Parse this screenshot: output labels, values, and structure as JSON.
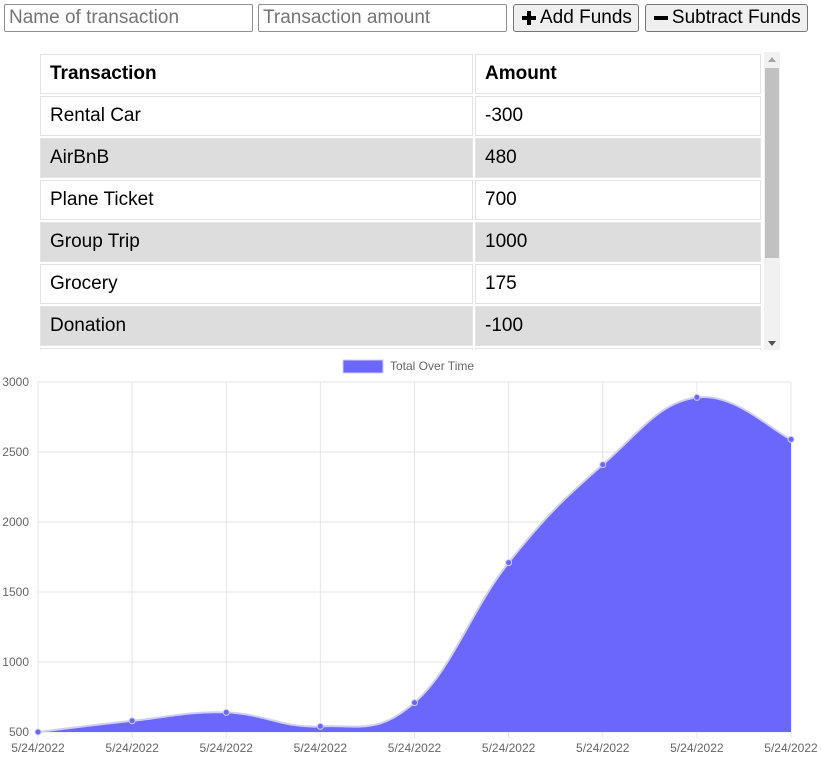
{
  "form": {
    "name_placeholder": "Name of transaction",
    "amount_placeholder": "Transaction amount",
    "add_label": "Add Funds",
    "subtract_label": "Subtract Funds"
  },
  "table": {
    "headers": [
      "Transaction",
      "Amount"
    ],
    "rows": [
      {
        "name": "Rental Car",
        "amount": "-300"
      },
      {
        "name": "AirBnB",
        "amount": "480"
      },
      {
        "name": "Plane Ticket",
        "amount": "700"
      },
      {
        "name": "Group Trip",
        "amount": "1000"
      },
      {
        "name": "Grocery",
        "amount": "175"
      },
      {
        "name": "Donation",
        "amount": "-100"
      }
    ]
  },
  "colors": {
    "fill": "#6b66fc",
    "line": "#cfcfff",
    "grid": "#e5e5e5",
    "row_alt": "#dddddd"
  },
  "chart_data": {
    "type": "area",
    "legend": "Total Over Time",
    "legend_position": "top-center",
    "x": [
      "5/24/2022",
      "5/24/2022",
      "5/24/2022",
      "5/24/2022",
      "5/24/2022",
      "5/24/2022",
      "5/24/2022",
      "5/24/2022",
      "5/24/2022"
    ],
    "values": [
      500,
      580,
      640,
      540,
      710,
      1710,
      2410,
      2890,
      2590
    ],
    "ylim": [
      500,
      3000
    ],
    "yticks": [
      500,
      1000,
      1500,
      2000,
      2500,
      3000
    ],
    "grid": true
  }
}
